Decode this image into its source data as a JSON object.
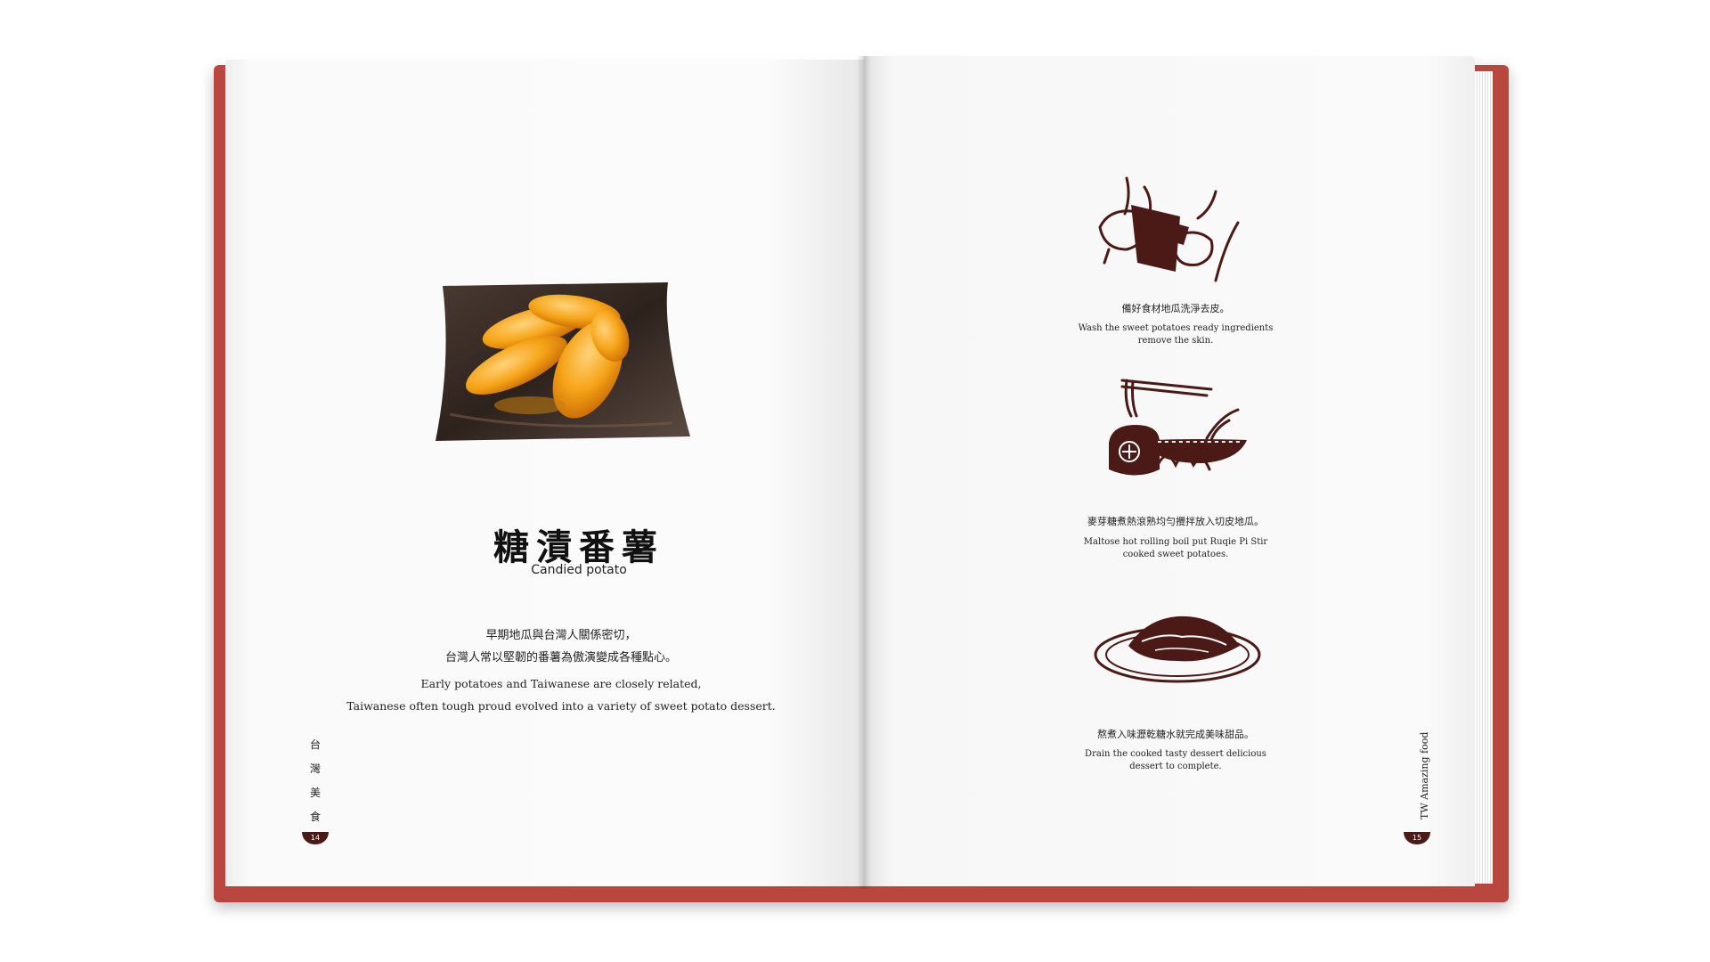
{
  "left_page": {
    "title_zh": "糖漬番薯",
    "title_en": "Candied potato",
    "description_zh": [
      "早期地瓜與台灣人關係密切，",
      "台灣人常以堅韌的番薯為傲演變成各種點心。"
    ],
    "description_en": [
      "Early potatoes and Taiwanese are closely related,",
      "Taiwanese often tough proud evolved into a variety of sweet potato dessert."
    ],
    "side_label": [
      "台",
      "灣",
      "美",
      "食"
    ],
    "page_number": "14",
    "image": "candied-sweet-potato-photo"
  },
  "right_page": {
    "steps": [
      {
        "zh": "備好食材地瓜洗淨去皮。",
        "en": [
          "Wash the sweet potatoes ready ingredients",
          "remove the skin."
        ],
        "icon": "peeling-hands-icon"
      },
      {
        "zh": "麥芽糖煮熱滾熟均勻攪拌放入切皮地瓜。",
        "en": [
          "Maltose hot rolling boil put Ruqie Pi Stir",
          "cooked sweet potatoes."
        ],
        "icon": "cooking-pot-icon"
      },
      {
        "zh": "熬煮入味瀝乾糖水就完成美味甜品。",
        "en": [
          "Drain the cooked tasty dessert delicious",
          "dessert to complete."
        ],
        "icon": "plated-dessert-icon"
      }
    ],
    "side_label": "TW Amazing food",
    "page_number": "15"
  },
  "colors": {
    "cover": "#b9473f",
    "ink": "#4b1a17",
    "page": "#fafafa"
  }
}
